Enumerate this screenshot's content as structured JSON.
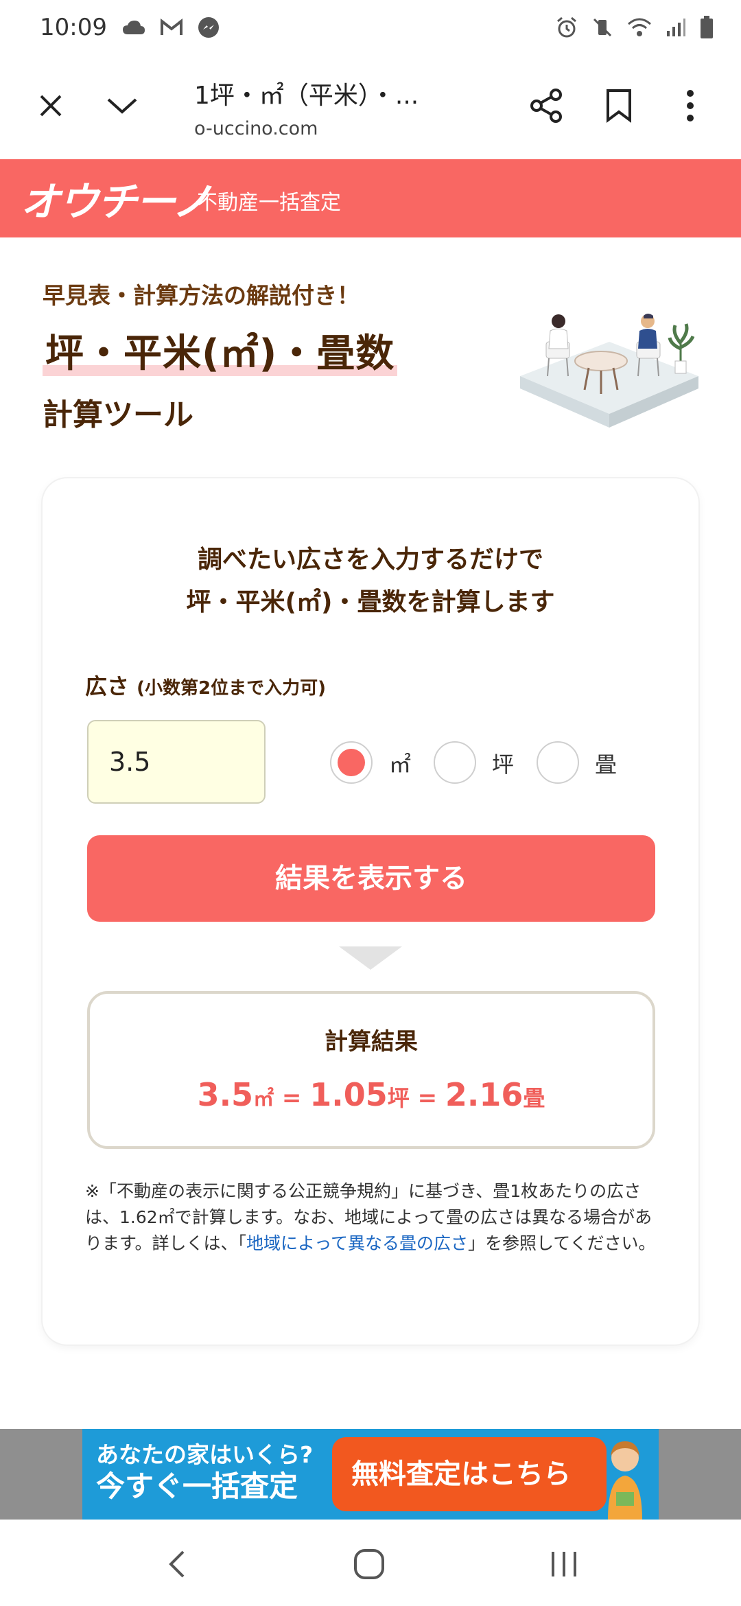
{
  "status_bar": {
    "time": "10:09",
    "left_icons": [
      "cloud-icon",
      "gmail-icon",
      "messenger-icon"
    ],
    "right_icons": [
      "alarm-icon",
      "vibrate-mute-icon",
      "wifi-icon",
      "signal-icon",
      "battery-icon"
    ]
  },
  "browser": {
    "title": "1坪・㎡（平米）・...",
    "url": "o-uccino.com"
  },
  "site_header": {
    "logo": "オウチーノ",
    "subtitle": "不動産一括査定"
  },
  "hero": {
    "subtitle": "早見表・計算方法の解説付き！",
    "title": "坪・平米(㎡)・畳数",
    "title2": "計算ツール"
  },
  "calculator": {
    "heading_line1": "調べたい広さを入力するだけで",
    "heading_line2": "坪・平米(㎡)・畳数を計算します",
    "field_label": "広さ",
    "field_hint": "(小数第2位まで入力可)",
    "input_value": "3.5",
    "units": [
      {
        "label": "㎡",
        "checked": true
      },
      {
        "label": "坪",
        "checked": false
      },
      {
        "label": "畳",
        "checked": false
      }
    ],
    "button_label": "結果を表示する",
    "result_title": "計算結果",
    "result": {
      "sqm": "3.5",
      "sqm_unit": "㎡",
      "eq1": " = ",
      "tsubo": "1.05",
      "tsubo_unit": "坪",
      "eq2": " = ",
      "jo": "2.16",
      "jo_unit": "畳"
    },
    "note_prefix": "※「不動産の表示に関する公正競争規約」に基づき、畳1枚あたりの広さは、1.62㎡で計算します。なお、地域によって畳の広さは異なる場合があります。詳しくは、「",
    "note_link": "地域によって異なる畳の広さ",
    "note_suffix": "」を参照してください。"
  },
  "banner": {
    "line1": "あなたの家はいくら?",
    "line2": "今すぐ一括査定",
    "button": "無料査定はこちら"
  },
  "colors": {
    "accent": "#f96763",
    "brown_text": "#4a2608",
    "link": "#1a66c2",
    "banner_blue": "#1e9bd8",
    "banner_orange": "#f2581f"
  }
}
